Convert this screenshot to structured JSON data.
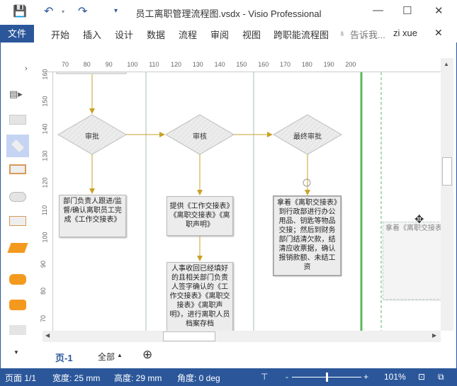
{
  "titlebar": {
    "title": "员工离职管理流程图.vsdx - Visio Professional"
  },
  "ribbon": {
    "file": "文件",
    "tabs": [
      "开始",
      "插入",
      "设计",
      "数据",
      "流程",
      "审阅",
      "视图",
      "跨职能流程图"
    ],
    "tell_me": "告诉我...",
    "user": "zi xue"
  },
  "ruler": {
    "h": [
      "70",
      "80",
      "90",
      "100",
      "110",
      "120",
      "130",
      "140",
      "150",
      "160",
      "170",
      "180",
      "190",
      "200"
    ],
    "v": [
      "160",
      "150",
      "140",
      "130",
      "120",
      "110",
      "100",
      "90",
      "80",
      "70"
    ]
  },
  "diagram": {
    "diamonds": [
      "审批",
      "审核",
      "最终审批"
    ],
    "box1": "部门负责人跟进/监督/确认离职员工完成《工作交接表》",
    "box2": "提供《工作交接表》《离职交接表》《离职声明》",
    "box3": "人事收回已经填好的且相关部门负责人签字确认的《工作交接表》《离职交接表》《离职声明》，进行离职人员档案存档",
    "box4": "拿着《离职交接表》到行政部进行办公用品、钥匙等物品交接；然后到财务部门结清欠款，结清应收票据，确认报销款额、未结工资"
  },
  "pages": {
    "current": "页-1",
    "all": "全部"
  },
  "status": {
    "page": "页面 1/1",
    "width": "宽度: 25 mm",
    "height": "高度: 29 mm",
    "angle": "角度: 0 deg",
    "zoom": "101%",
    "zoom_fraction": 0.5
  },
  "colors": {
    "brand": "#2b579a",
    "arrow": "#c9a227",
    "lane_green": "#5cb85c"
  }
}
